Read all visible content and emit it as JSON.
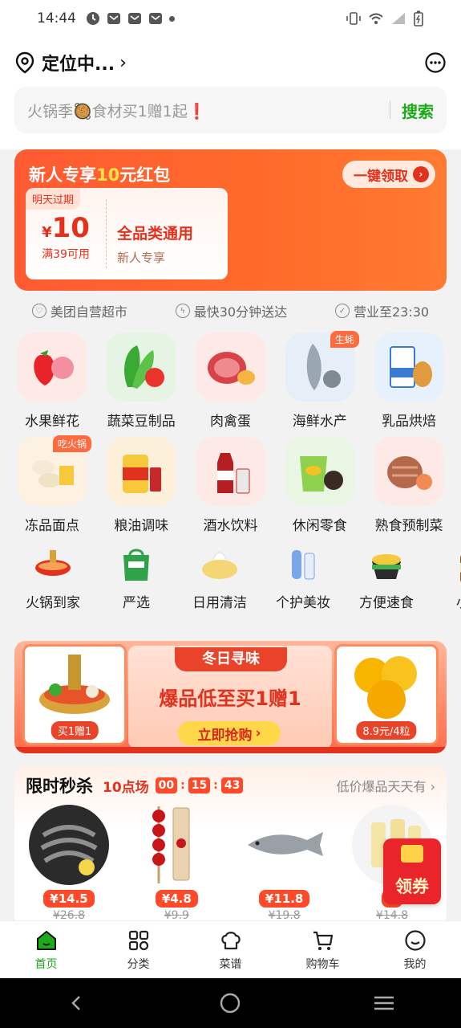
{
  "status": {
    "time": "14:44"
  },
  "header": {
    "location": "定位中...",
    "search_placeholder": "火锅季🥘食材买1赠1起❗",
    "search_button": "搜索"
  },
  "new_user": {
    "title_prefix": "新人专享",
    "title_amount": "10",
    "title_suffix": "元红包",
    "claim_label": "一键领取",
    "expire_tag": "明天过期",
    "currency": "¥",
    "amount": "10",
    "condition": "满39可用",
    "scope": "全品类通用",
    "scope_sub": "新人专享"
  },
  "features": [
    "美团自营超市",
    "最快30分钟送达",
    "营业至23:30"
  ],
  "categories": [
    {
      "label": "水果鲜花"
    },
    {
      "label": "蔬菜豆制品"
    },
    {
      "label": "肉禽蛋"
    },
    {
      "label": "海鲜水产",
      "badge": "生蚝"
    },
    {
      "label": "乳品烘焙"
    },
    {
      "label": "冻品面点",
      "badge": "吃火锅"
    },
    {
      "label": "粮油调味"
    },
    {
      "label": "酒水饮料"
    },
    {
      "label": "休闲零食"
    },
    {
      "label": "熟食预制菜"
    }
  ],
  "subcategories": [
    "火锅到家",
    "严选",
    "日用清洁",
    "个护美妆",
    "方便速食",
    "小酒"
  ],
  "banner": {
    "tag": "冬日寻味",
    "title": "爆品低至买1赠1",
    "button": "立即抢购",
    "left_caption": "买1赠1",
    "right_caption": "8.9元/4粒"
  },
  "flash_sale": {
    "title": "限时秒杀",
    "slot": "10点场",
    "hours": "00",
    "minutes": "15",
    "seconds": "43",
    "more": "低价爆品天天有",
    "items": [
      {
        "price": "¥14.5",
        "original": "¥26.8"
      },
      {
        "price": "¥4.8",
        "original": "¥9.9"
      },
      {
        "price": "¥11.8",
        "original": "¥19.8"
      },
      {
        "price": "¥",
        "original": "¥14.8"
      }
    ]
  },
  "float_coupon": "领券",
  "tabs": [
    {
      "label": "首页",
      "active": true
    },
    {
      "label": "分类"
    },
    {
      "label": "菜谱"
    },
    {
      "label": "购物车"
    },
    {
      "label": "我的"
    }
  ],
  "colors": {
    "brand_green": "#1aad19",
    "promo_red": "#ff5a33"
  }
}
